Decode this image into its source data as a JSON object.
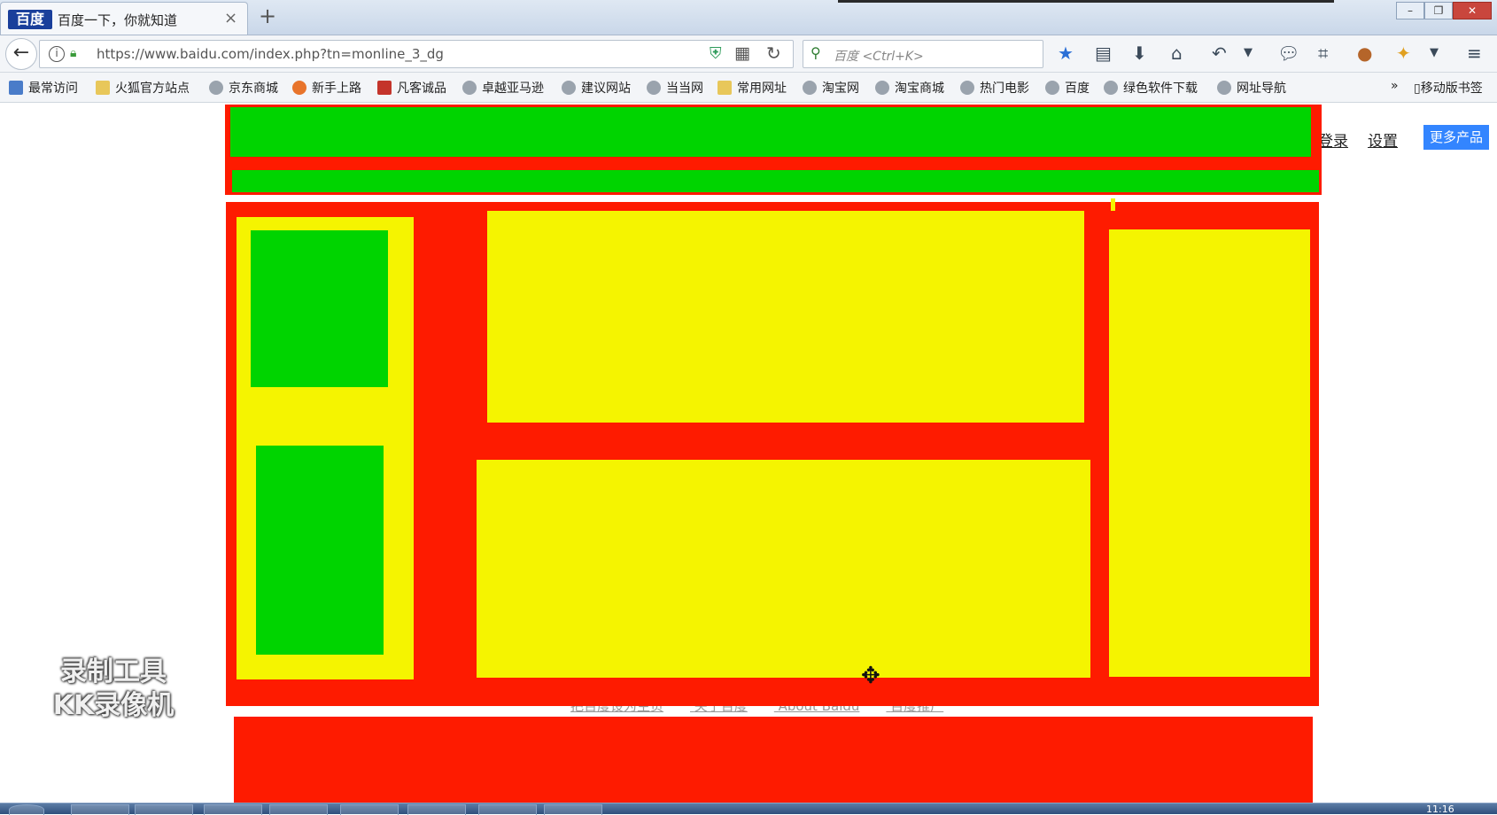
{
  "browser": {
    "tab_logo": "百度",
    "tab_title": "百度一下，你就知道",
    "tab_close": "×",
    "new_tab": "+",
    "win_min": "–",
    "win_max": "❐",
    "win_close": "✕",
    "back": "←",
    "url": "https://www.baidu.com/index.php?tn=monline_3_dg",
    "search_placeholder": "百度 <Ctrl+K>",
    "bookmarks": [
      "最常访问",
      "火狐官方站点",
      "京东商城",
      "新手上路",
      "凡客诚品",
      "卓越亚马逊",
      "建议网站",
      "当当网",
      "常用网址",
      "淘宝网",
      "淘宝商城",
      "热门电影",
      "百度",
      "绿色软件下载",
      "网址导航"
    ],
    "bookmarks_overflow": "»",
    "mobile_bookmarks": "移动版书签"
  },
  "page": {
    "nav_login": "登录",
    "nav_settings": "设置",
    "more_products": "更多产品",
    "footer_links": [
      "把百度设为主页",
      "关于百度",
      "About Baidu",
      "百度推广"
    ],
    "colors": {
      "red": "#fe1b00",
      "green": "#00d400",
      "yellow": "#f5f400",
      "accent": "#3385ff"
    }
  },
  "overlay": {
    "watermark_line1": "录制工具",
    "watermark_line2": "KK录像机"
  },
  "taskbar": {
    "clock": "11:16"
  }
}
